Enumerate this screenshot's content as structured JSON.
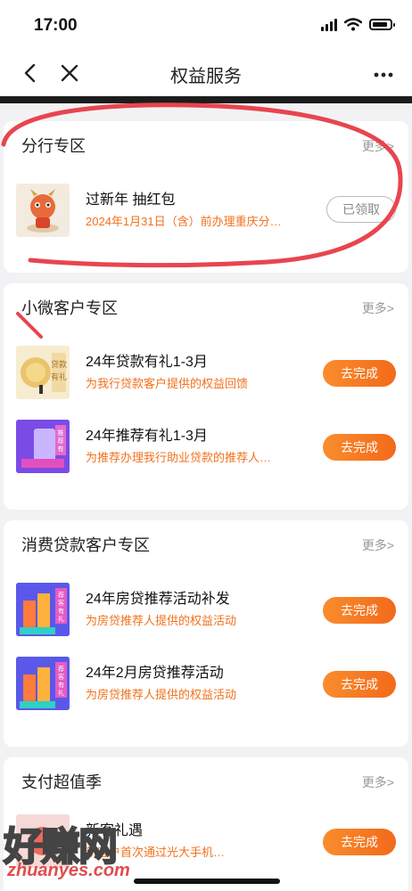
{
  "status_bar": {
    "time": "17:00"
  },
  "nav": {
    "title": "权益服务"
  },
  "sections": [
    {
      "title": "分行专区",
      "more": "更多>",
      "items": [
        {
          "title": "过新年 抽红包",
          "desc": "2024年1月31日（含）前办理重庆分…",
          "button": "已领取",
          "button_state": "claimed",
          "icon": "dragon-mascot-icon"
        }
      ]
    },
    {
      "title": "小微客户专区",
      "more": "更多>",
      "items": [
        {
          "title": "24年贷款有礼1-3月",
          "desc": "为我行贷款客户提供的权益回馈",
          "button": "去完成",
          "button_state": "todo",
          "icon": "loan-gift-icon",
          "icon_text": "贷款有礼"
        },
        {
          "title": "24年推荐有礼1-3月",
          "desc": "为推荐办理我行助业贷款的推荐人…",
          "button": "去完成",
          "button_state": "todo",
          "icon": "referral-gift-icon",
          "icon_text": "推荐有礼"
        }
      ]
    },
    {
      "title": "消费贷款客户专区",
      "more": "更多>",
      "items": [
        {
          "title": "24年房贷推荐活动补发",
          "desc": "为房贷推荐人提供的权益活动",
          "button": "去完成",
          "button_state": "todo",
          "icon": "mortgage-referral-icon",
          "icon_text": "荐客有礼"
        },
        {
          "title": "24年2月房贷推荐活动",
          "desc": "为房贷推荐人提供的权益活动",
          "button": "去完成",
          "button_state": "todo",
          "icon": "mortgage-referral-icon",
          "icon_text": "荐客有礼"
        }
      ]
    },
    {
      "title": "支付超值季",
      "more": "更多>",
      "items": [
        {
          "title": "新客礼遇",
          "desc": "新客户首次通过光大手机…",
          "button": "去完成",
          "button_state": "todo",
          "icon": "new-customer-icon"
        }
      ]
    }
  ],
  "watermark": {
    "text": "好赚网",
    "url": "zhuanyes.com"
  },
  "colors": {
    "accent": "#f26a1b",
    "desc": "#f2711c",
    "annotation": "#e8454f"
  }
}
